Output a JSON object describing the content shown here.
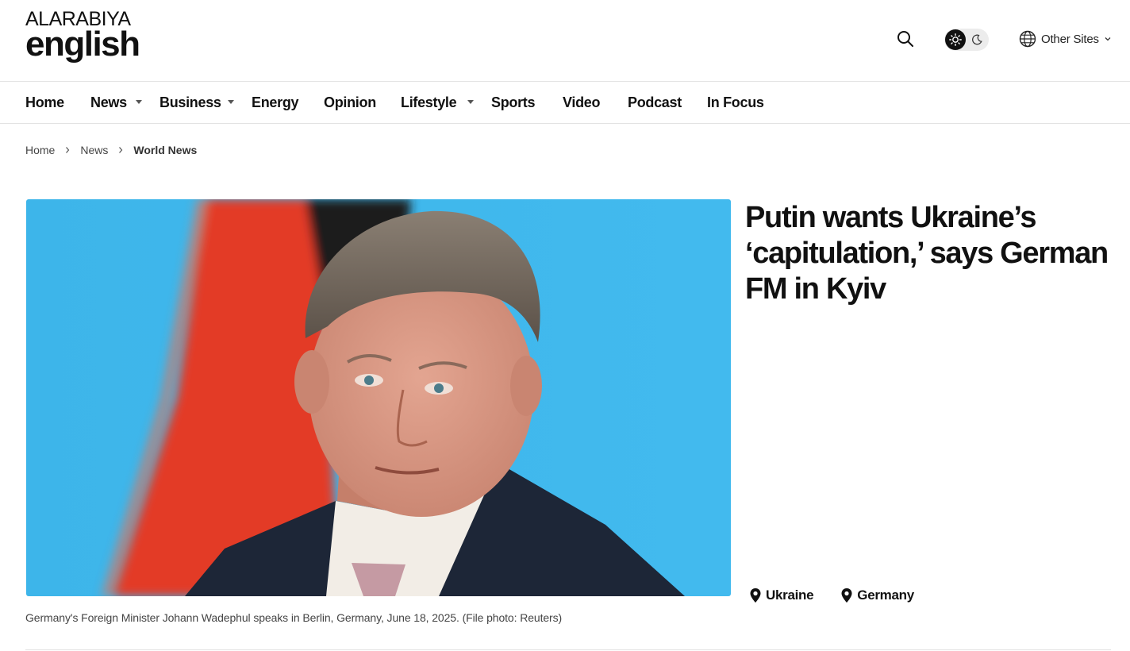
{
  "header": {
    "logo_top": "ALARABIYA",
    "logo_bottom": "english",
    "other_sites_label": "Other Sites"
  },
  "nav": {
    "items": [
      {
        "label": "Home"
      },
      {
        "label": "News",
        "dropdown": true
      },
      {
        "label": "Business",
        "dropdown": true
      },
      {
        "label": "Energy"
      },
      {
        "label": "Opinion"
      },
      {
        "label": "Lifestyle",
        "dropdown": true
      },
      {
        "label": "Sports"
      },
      {
        "label": "Video"
      },
      {
        "label": "Podcast"
      },
      {
        "label": "In Focus"
      }
    ]
  },
  "breadcrumb": {
    "items": [
      "Home",
      "News",
      "World News"
    ]
  },
  "article": {
    "headline": "Putin wants Ukraine’s ‘capitulation,’ says German FM in Kyiv",
    "caption": "Germany's Foreign Minister Johann Wadephul speaks in Berlin, Germany, June 18, 2025. (File photo: Reuters)",
    "tags": [
      "Ukraine",
      "Germany"
    ]
  },
  "colors": {
    "image_background": "#3fb8ec",
    "flag_red": "#e33a26",
    "flag_black": "#1c1c1c",
    "suit": "#1d2637"
  }
}
